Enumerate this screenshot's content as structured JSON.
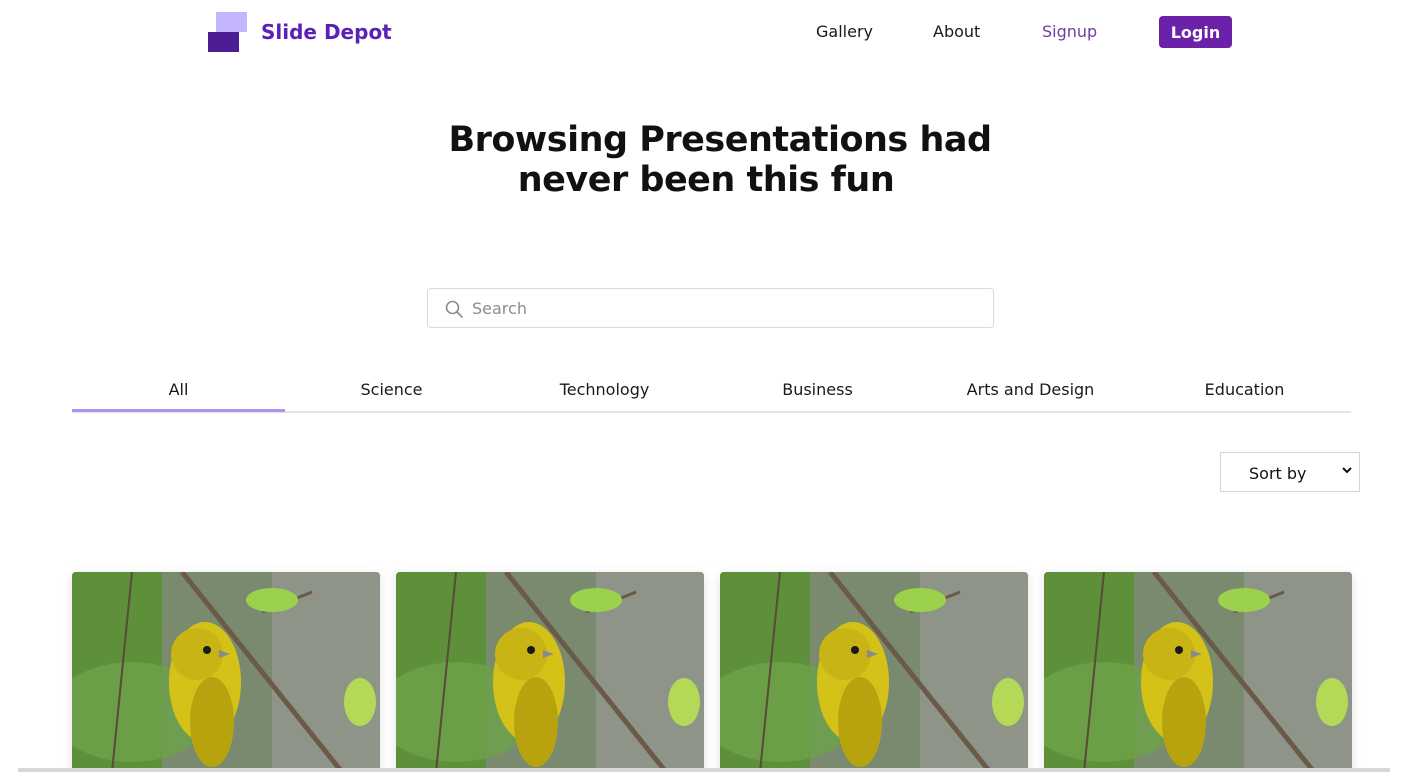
{
  "brand": {
    "name": "Slide Depot",
    "colors": {
      "light": "#c4b5fd",
      "dark": "#4c1d95",
      "text": "#5b21b6"
    }
  },
  "nav": {
    "gallery": "Gallery",
    "about": "About",
    "signup": "Signup",
    "login": "Login"
  },
  "hero": {
    "line1": "Browsing Presentations had",
    "line2": "never been this fun"
  },
  "search": {
    "placeholder": "Search",
    "icon": "search-icon"
  },
  "tabs": [
    {
      "label": "All",
      "active": true
    },
    {
      "label": "Science"
    },
    {
      "label": "Technology"
    },
    {
      "label": "Business"
    },
    {
      "label": "Arts and Design"
    },
    {
      "label": "Education"
    }
  ],
  "sort": {
    "selected": "Sort by"
  },
  "cards": [
    {
      "image": "yellow-bird-on-branch"
    },
    {
      "image": "yellow-bird-on-branch"
    },
    {
      "image": "yellow-bird-on-branch"
    },
    {
      "image": "yellow-bird-on-branch"
    }
  ],
  "accent": {
    "primary": "#6b21a8",
    "tab_underline": "#b18df7"
  }
}
